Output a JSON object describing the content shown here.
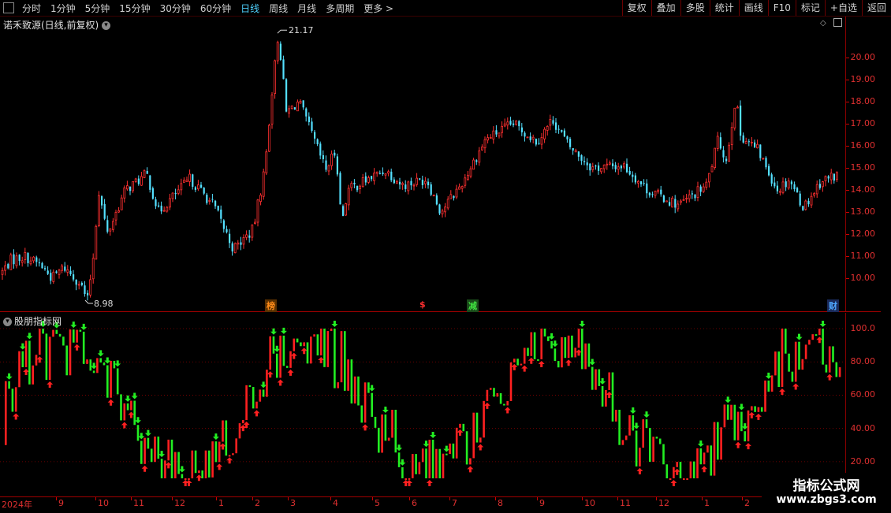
{
  "toolbar": {
    "periods": [
      "分时",
      "1分钟",
      "5分钟",
      "15分钟",
      "30分钟",
      "60分钟",
      "日线",
      "周线",
      "月线",
      "多周期",
      "更多 >"
    ],
    "active_period": "日线",
    "right_buttons": [
      "复权",
      "叠加",
      "多股",
      "统计",
      "画线",
      "F10",
      "标记",
      "+自选",
      "返回"
    ]
  },
  "main_panel": {
    "title": "诺禾致源(日线,前复权)",
    "high_label": "21.17",
    "low_label": "8.98",
    "y_ticks": [
      "20.00",
      "19.00",
      "18.00",
      "17.00",
      "16.00",
      "15.00",
      "14.00",
      "13.00",
      "12.00",
      "11.00",
      "10.00"
    ],
    "markers": [
      {
        "text": "榜",
        "color": "#ff8c1a"
      },
      {
        "text": "$",
        "color": "#ff3030"
      },
      {
        "text": "减",
        "color": "#40e040"
      },
      {
        "text": "财",
        "color": "#4fa8ff"
      }
    ]
  },
  "indicator_panel": {
    "title": "股朋指标网",
    "y_ticks": [
      "100.0",
      "80.00",
      "60.00",
      "40.00",
      "20.00"
    ]
  },
  "x_axis": {
    "labels": [
      "2024年",
      "9",
      "10",
      "11",
      "12",
      "1",
      "2",
      "3",
      "4",
      "5",
      "6",
      "7",
      "8",
      "9",
      "10",
      "11",
      "12",
      "1",
      "2"
    ]
  },
  "watermark": {
    "line1": "指标公式网",
    "line2": "www.zbgs3.com"
  },
  "colors": {
    "up": "#ff3030",
    "down": "#54e0ff",
    "ind_up": "#ff2020",
    "ind_down": "#22ee22",
    "grid": "#8a0000"
  },
  "chart_data": {
    "type": "candlestick",
    "ylim": [
      9.0,
      21.5
    ],
    "indicator_ylim": [
      10,
      100
    ],
    "price_path": [
      [
        0,
        10.2
      ],
      [
        12,
        10.8
      ],
      [
        30,
        11.0
      ],
      [
        50,
        10.6
      ],
      [
        65,
        10.0
      ],
      [
        80,
        10.5
      ],
      [
        100,
        9.8
      ],
      [
        110,
        9.0
      ],
      [
        118,
        11.2
      ],
      [
        124,
        14.0
      ],
      [
        135,
        12.0
      ],
      [
        158,
        14.0
      ],
      [
        185,
        14.7
      ],
      [
        200,
        13.0
      ],
      [
        240,
        14.5
      ],
      [
        270,
        13.3
      ],
      [
        295,
        11.3
      ],
      [
        320,
        12.2
      ],
      [
        335,
        15.0
      ],
      [
        344,
        18.5
      ],
      [
        352,
        21.1
      ],
      [
        362,
        17.5
      ],
      [
        378,
        18.0
      ],
      [
        400,
        16.0
      ],
      [
        412,
        14.9
      ],
      [
        425,
        15.8
      ],
      [
        432,
        12.5
      ],
      [
        440,
        14.0
      ],
      [
        488,
        14.9
      ],
      [
        510,
        14.2
      ],
      [
        540,
        14.5
      ],
      [
        558,
        13.0
      ],
      [
        585,
        14.3
      ],
      [
        615,
        16.3
      ],
      [
        650,
        17.0
      ],
      [
        680,
        16.2
      ],
      [
        700,
        17.2
      ],
      [
        720,
        16.0
      ],
      [
        750,
        15.0
      ],
      [
        790,
        15.1
      ],
      [
        820,
        14.0
      ],
      [
        860,
        13.3
      ],
      [
        895,
        14.2
      ],
      [
        910,
        16.3
      ],
      [
        920,
        15.3
      ],
      [
        932,
        18.2
      ],
      [
        938,
        16.5
      ],
      [
        960,
        15.8
      ],
      [
        985,
        14.0
      ],
      [
        1000,
        14.5
      ],
      [
        1018,
        13.2
      ],
      [
        1040,
        14.4
      ],
      [
        1062,
        14.7
      ]
    ]
  }
}
